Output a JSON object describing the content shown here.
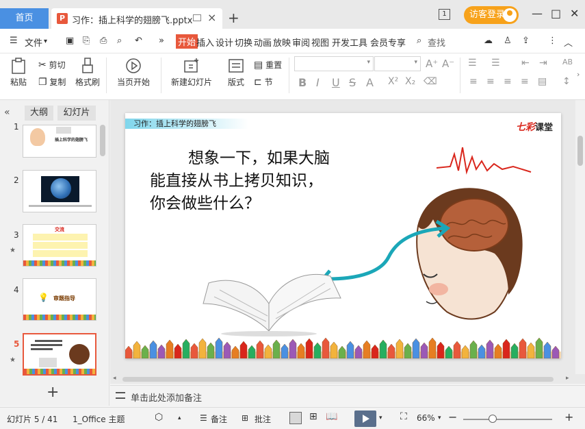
{
  "titlebar": {
    "home_tab": "首页",
    "doc_tab": "习作：插上科学的翅膀飞.pptx",
    "doc_icon_letter": "P",
    "add_tab": "+",
    "page_badge": "1",
    "login": "访客登录"
  },
  "menu": {
    "file": "文件",
    "start": "开始",
    "items": [
      "插入",
      "设计",
      "切换",
      "动画",
      "放映",
      "审阅",
      "视图",
      "开发工具",
      "会员专享"
    ],
    "search": "查找"
  },
  "ribbon": {
    "paste": "粘贴",
    "cut": "剪切",
    "copy": "复制",
    "format_painter": "格式刷",
    "from_start": "当页开始",
    "new_slide": "新建幻灯片",
    "layout": "版式",
    "reset": "重置",
    "section": "节"
  },
  "sidebar": {
    "tab_outline": "大纲",
    "tab_slides": "幻灯片",
    "slides": [
      {
        "num": "1",
        "title": "插上科学的翅膀飞"
      },
      {
        "num": "2",
        "title": ""
      },
      {
        "num": "3",
        "title": "交流"
      },
      {
        "num": "4",
        "title": "审题指导"
      },
      {
        "num": "5",
        "title": ""
      }
    ],
    "add": "+"
  },
  "slide": {
    "banner": "习作：插上科学的翅膀飞",
    "logo_main": "七彩",
    "logo_sub": "课堂",
    "question": [
      "想象一下，如果大脑",
      "能直接从书上拷贝知识，",
      "你会做些什么？"
    ]
  },
  "notes": {
    "placeholder": "单击此处添加备注"
  },
  "status": {
    "slide_counter": "幻灯片 5 / 41",
    "theme": "1_Office 主题",
    "notes_btn": "备注",
    "comment_btn": "批注",
    "zoom": "66%",
    "minus": "−",
    "plus": "+"
  },
  "colors": {
    "accent": "#e8583c",
    "tab_blue": "#4a90e2",
    "login_orange": "#f7a21b"
  }
}
